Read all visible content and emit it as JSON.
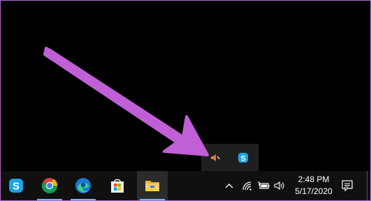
{
  "taskbar": {
    "apps": [
      {
        "name": "Skype",
        "icon": "skype-icon",
        "running": false
      },
      {
        "name": "Google Chrome",
        "icon": "chrome-icon",
        "running": true
      },
      {
        "name": "Microsoft Edge",
        "icon": "edge-icon",
        "running": true
      },
      {
        "name": "Microsoft Store",
        "icon": "store-icon",
        "running": false
      },
      {
        "name": "File Explorer",
        "icon": "folder-icon",
        "running": true
      }
    ],
    "tray": {
      "icons": [
        "chevron-up-icon",
        "wifi-icon",
        "battery-icon",
        "volume-icon"
      ]
    },
    "clock": {
      "time": "2:48 PM",
      "date": "5/17/2020"
    },
    "notification_icon": "action-center-icon"
  },
  "tray_overflow": {
    "icons": [
      "volume-muted-icon",
      "skype-icon"
    ]
  },
  "colors": {
    "annotation_arrow": "#c15fd6",
    "skype": "#1aa3e8",
    "frame_border": "#b06cc3"
  }
}
